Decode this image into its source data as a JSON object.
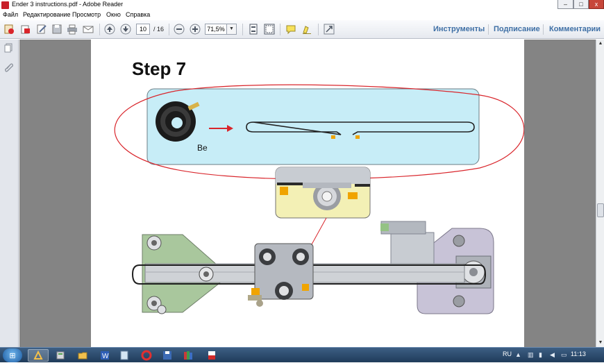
{
  "window": {
    "title": "Ender 3 instructions.pdf - Adobe Reader",
    "min_label": "–",
    "max_label": "□",
    "close_label": "x"
  },
  "menu": {
    "items": [
      "Файл",
      "Редактирование",
      "Просмотр",
      "Окно",
      "Справка"
    ]
  },
  "toolbar": {
    "current_page": "10",
    "total_pages": "/ 16",
    "zoom": "71,5%",
    "zoom_drop": "▼",
    "tools_label": "Инструменты",
    "sign_label": "Подписание",
    "comments_label": "Комментарии"
  },
  "document": {
    "step_title": "Step 7",
    "belt_label": "Be",
    "colors": {
      "accent_box": "#c7edf7",
      "annotation": "#d9252b",
      "detail_bg": "#f3f0b5",
      "printer_grey": "#c8ccd2",
      "bracket_green": "#a9c79d",
      "motor_violet": "#c8c3d7",
      "part_orange": "#f0a400"
    }
  },
  "taskbar": {
    "lang": "RU",
    "time": "11:13"
  },
  "icons": {
    "toolbar": [
      "create-icon",
      "open-icon",
      "edit-icon",
      "save-icon",
      "print-icon",
      "email-icon",
      "page-up-icon",
      "page-down-icon",
      "zoom-out-icon",
      "zoom-in-icon",
      "fit-page-icon",
      "fit-width-icon",
      "comment-icon",
      "highlight-icon",
      "fullscreen-icon"
    ],
    "taskbar": [
      "reader-icon",
      "explorer-icon",
      "folder-icon",
      "word-icon",
      "notepad-icon",
      "opera-icon",
      "save-disk-icon",
      "books-icon",
      "pdf-icon"
    ]
  }
}
